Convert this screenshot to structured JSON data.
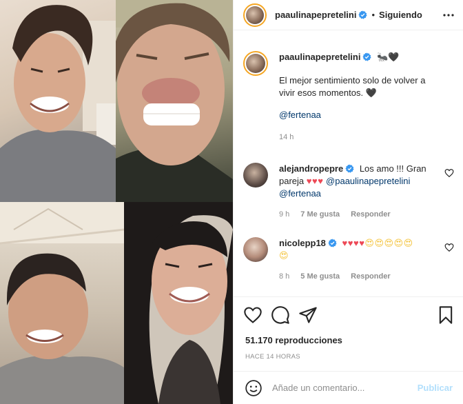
{
  "post": {
    "author": "paaulinapepretelini",
    "follow_state": "Siguiendo",
    "separator": "•"
  },
  "caption": {
    "author": "paaulinapepretelini",
    "emoji": "🐜🖤",
    "text": "El mejor sentimiento solo de volver a vivir esos momentos. 🖤",
    "mention": "@fertenaa",
    "time": "14 h"
  },
  "comments": [
    {
      "author": "alejandropepre",
      "text": "Los amo !!! Gran pareja",
      "hearts": "♥♥♥",
      "mention1": "@paaulinapepretelini",
      "mention2": "@fertenaa",
      "time": "9 h",
      "likes": "7 Me gusta",
      "reply": "Responder"
    },
    {
      "author": "nicolepp18",
      "hearts": "♥♥♥♥",
      "emojis": "😍😍😍😍😍",
      "emojis2": "😍",
      "time": "8 h",
      "likes": "5 Me gusta",
      "reply": "Responder"
    }
  ],
  "stats": {
    "views": "51.170 reproducciones",
    "posted": "HACE 14 HORAS"
  },
  "composer": {
    "placeholder": "Añade un comentario...",
    "post_label": "Publicar"
  },
  "icons": {
    "verified": "verified-badge-icon",
    "like": "heart-icon",
    "comment": "comment-bubble-icon",
    "share": "paper-plane-icon",
    "save": "bookmark-icon",
    "more": "more-options-icon",
    "emoji": "smiley-icon"
  },
  "colors": {
    "verified": "#3897f0",
    "mention": "#00376b",
    "heart": "#ed4956",
    "post_disabled": "#b2dffc",
    "story_ring": "#f5a623"
  }
}
